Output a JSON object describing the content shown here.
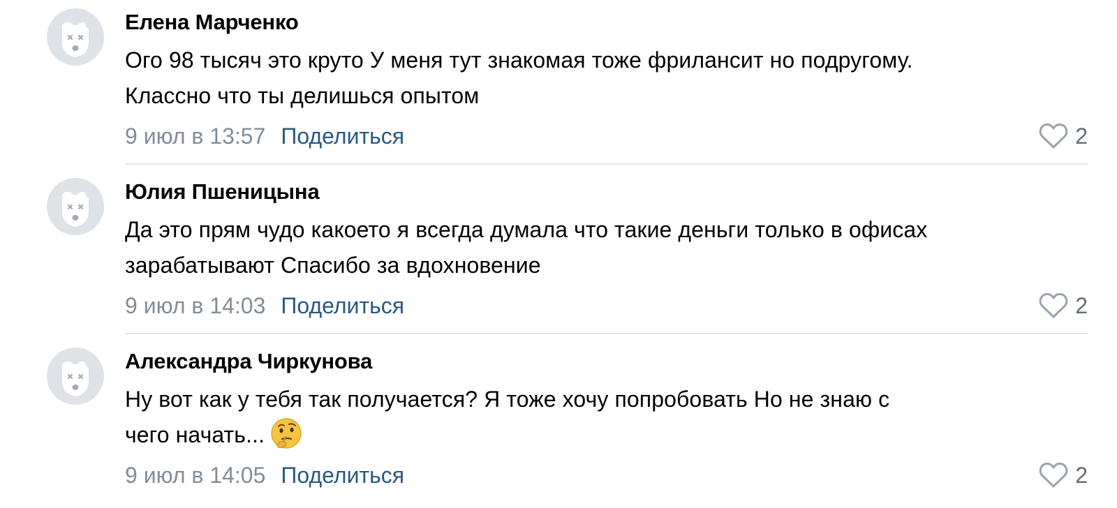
{
  "comments": [
    {
      "author": "Елена Марченко",
      "text_lines": [
        "Ого 98 тысяч это круто У меня тут знакомая тоже фрилансит но подругому.",
        "Классно что ты делишься опытом"
      ],
      "date": "9 июл в 13:57",
      "share_label": "Поделиться",
      "likes": "2",
      "avatar_icon": "dog-avatar-icon",
      "emoji": ""
    },
    {
      "author": "Юлия Пшеницына",
      "text_lines": [
        "Да это прям чудо какоето я всегда думала что такие деньги только в офисах",
        "зарабатывают Спасибо за вдохновение"
      ],
      "date": "9 июл в 14:03",
      "share_label": "Поделиться",
      "likes": "2",
      "avatar_icon": "dog-avatar-icon",
      "emoji": ""
    },
    {
      "author": "Александра Чиркунова",
      "text_lines": [
        "Ну вот как у тебя так получается? Я тоже хочу попробовать Но не знаю с",
        "чего начать..."
      ],
      "date": "9 июл в 14:05",
      "share_label": "Поделиться",
      "likes": "2",
      "avatar_icon": "dog-avatar-icon",
      "emoji": "thinking-face-emoji"
    }
  ],
  "colors": {
    "author": "#000000",
    "text": "#000000",
    "date": "#818c99",
    "share_link": "#2a5885",
    "like_count": "#626d7a",
    "avatar_bg": "#dfe3e8",
    "separator": "#e7e8ec"
  }
}
